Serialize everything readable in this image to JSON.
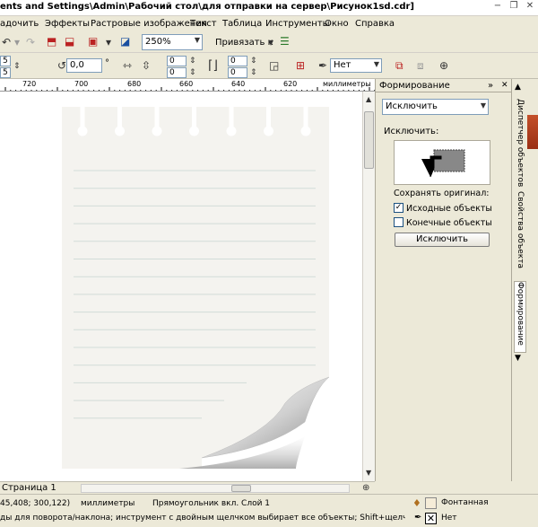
{
  "window": {
    "title": "ents and Settings\\Admin\\Рабочий стол\\для отправки на сервер\\Рисунок1sd.cdr]",
    "minimize_glyph": "−",
    "restore_glyph": "❐",
    "close_glyph": "✕"
  },
  "menu": {
    "items": [
      "адочить",
      "Эффекты",
      "Растровые изображения",
      "Текст",
      "Таблица",
      "Инструменты",
      "Окно",
      "Справка"
    ]
  },
  "toolbar": {
    "zoom_value": "250%",
    "snap_label": "Привязать к",
    "x_value": "5",
    "y_value": "5",
    "rotation_value": "0,0",
    "degree_symbol": "°",
    "spin1_value": "0",
    "spin2_value": "0",
    "spin3_value": "0",
    "spin4_value": "0",
    "outline_value": "Нет"
  },
  "ruler": {
    "ticks": [
      "720",
      "700",
      "680",
      "660",
      "640",
      "620"
    ],
    "unit": "миллиметры"
  },
  "docker": {
    "title": "Формирование",
    "mode_select": "Исключить",
    "mode_heading": "Исключить:",
    "keep_original_label": "Сохранять оригинал:",
    "source_objects_label": "Исходные объекты",
    "source_objects_checked": true,
    "target_objects_label": "Конечные объекты",
    "target_objects_checked": false,
    "apply_button": "Исключить"
  },
  "side_tabs": [
    "Диспетчер объектов",
    "Свойства объекта",
    "Формирование"
  ],
  "page_tab": {
    "label": "Страница 1"
  },
  "status": {
    "coords": "45,408; 300,122)",
    "units": "миллиметры",
    "object_info": "Прямоугольник вкл. Слой 1",
    "hint": "ды для поворота/наклона; инструмент с двойным щелчком выбирает все объекты; Shift+щелчок - выбор не...",
    "fill_label": "Фонтанная",
    "outline_label": "Нет"
  },
  "notepad": {
    "line_count": 15,
    "ring_count": 8
  }
}
